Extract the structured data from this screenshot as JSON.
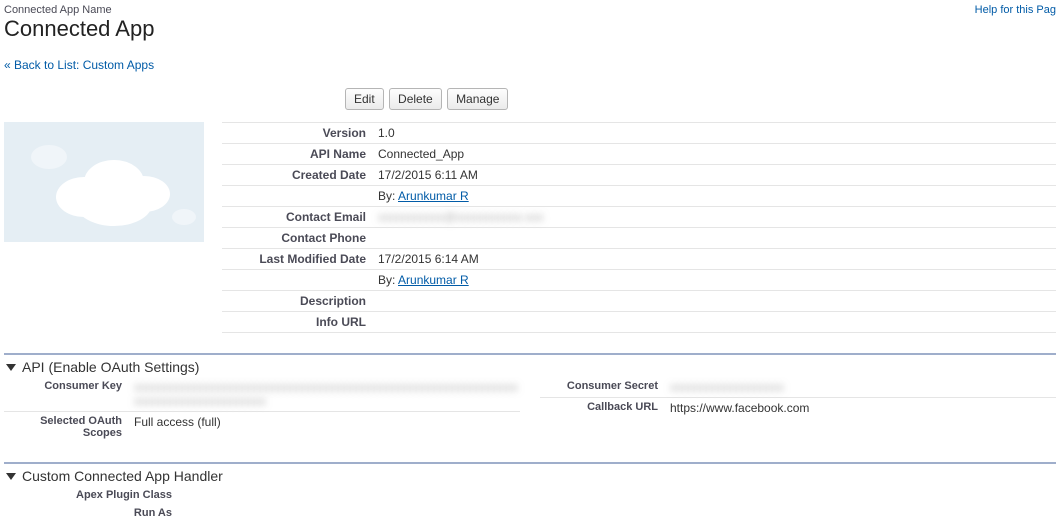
{
  "header": {
    "label": "Connected App Name",
    "title": "Connected App",
    "helpLink": "Help for this Pag",
    "backLink": "« Back to List: Custom Apps"
  },
  "buttons": {
    "edit": "Edit",
    "delete": "Delete",
    "manage": "Manage"
  },
  "details": {
    "versionLabel": "Version",
    "version": "1.0",
    "apiNameLabel": "API Name",
    "apiName": "Connected_App",
    "createdDateLabel": "Created Date",
    "createdDate": "17/2/2015 6:11 AM",
    "createdByPrefix": "By: ",
    "createdBy": "Arunkumar R",
    "contactEmailLabel": "Contact Email",
    "contactEmail": "xxxxxxxxxxx@xxxxxxxxxxx.xxx",
    "contactPhoneLabel": "Contact Phone",
    "contactPhone": "",
    "lastModifiedLabel": "Last Modified Date",
    "lastModified": "17/2/2015 6:14 AM",
    "lastModifiedByPrefix": "By: ",
    "lastModifiedBy": "Arunkumar R",
    "descriptionLabel": "Description",
    "description": "",
    "infoUrlLabel": "Info URL",
    "infoUrl": ""
  },
  "sections": {
    "api": {
      "title": "API (Enable OAuth Settings)",
      "consumerKeyLabel": "Consumer Key",
      "consumerKey": "xxxxxxxxxxxxxxxxxxxxxxxxxxxxxxxxxxxxxxxxxxxxxxxxxxxxxxxxxxxxxxxxxxxxxxxxxxxxxxxxxxxxxx",
      "consumerSecretLabel": "Consumer Secret",
      "consumerSecret": "xxxxxxxxxxxxxxxxxxx",
      "scopesLabel": "Selected OAuth Scopes",
      "scopes": "Full access (full)",
      "callbackUrlLabel": "Callback URL",
      "callbackUrl": "https://www.facebook.com"
    },
    "handler": {
      "title": "Custom Connected App Handler",
      "apexLabel": "Apex Plugin Class",
      "apex": "",
      "runAsLabel": "Run As",
      "runAs": ""
    }
  }
}
